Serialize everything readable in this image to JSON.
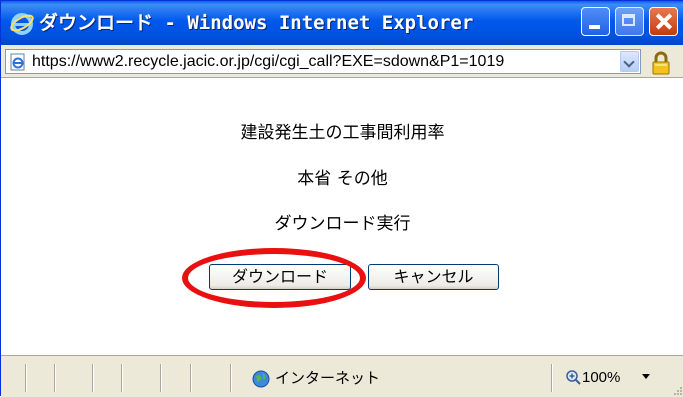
{
  "window": {
    "title": "ダウンロード - Windows Internet Explorer"
  },
  "address": {
    "url": "https://www2.recycle.jacic.or.jp/cgi/cgi_call?EXE=sdown&P1=1019"
  },
  "content": {
    "title_line": "建設発生土の工事間利用率",
    "subtitle_line": "本省 その他",
    "action_line": "ダウンロード実行",
    "download_button": "ダウンロード",
    "cancel_button": "キャンセル"
  },
  "status": {
    "zone": "インターネット",
    "zoom": "100%"
  },
  "colors": {
    "titlebar": "#0058ee",
    "highlight_ellipse": "#e81010",
    "chrome": "#ece9d8"
  },
  "icons": [
    "ie-logo-icon",
    "minimize-icon",
    "maximize-icon",
    "close-icon",
    "page-icon",
    "chevron-down-icon",
    "lock-icon",
    "globe-icon",
    "zoom-icon"
  ]
}
